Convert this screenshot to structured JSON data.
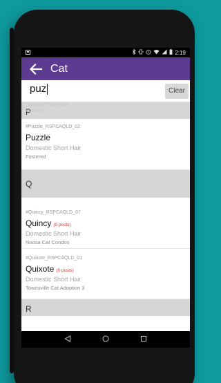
{
  "status_bar": {
    "time": "2:19",
    "left_icon": "notification-icon",
    "right_icons": [
      "bluetooth-icon",
      "vibrate-icon",
      "alarm-icon",
      "wifi-icon",
      "signal-icon",
      "battery-icon"
    ]
  },
  "app_bar": {
    "title": "Cat",
    "back_icon": "arrow-back-icon",
    "color": "#5c3b91"
  },
  "search": {
    "value": "puz",
    "clear_label": "Clear"
  },
  "list": {
    "ghost_top": [
      "Domestic Short Hair",
      "Fostered"
    ],
    "sections": [
      {
        "letter": "P",
        "items": [
          {
            "id": "#Puzzle_RSPCAQLD_02",
            "name": "Puzzle",
            "posts": "",
            "breed": "Domestic Short Hair",
            "status": "Fostered"
          }
        ]
      },
      {
        "letter": "Q",
        "items": [
          {
            "id": "#Quincy_RSPCAQLD_07",
            "name": "Quincy",
            "posts": "(0 posts)",
            "breed": "Domestic Short Hair",
            "status": "Noosa Cat Condos"
          },
          {
            "id": "#Quixote_RSPCAQLD_01",
            "name": "Quixote",
            "posts": "(0 posts)",
            "breed": "Domestic Short Hair",
            "status": "Townsville Cat Adoption 3"
          }
        ]
      },
      {
        "letter": "R",
        "items": []
      }
    ]
  },
  "nav_bar": {
    "icons": [
      "back-triangle-icon",
      "home-circle-icon",
      "recents-square-icon"
    ]
  }
}
